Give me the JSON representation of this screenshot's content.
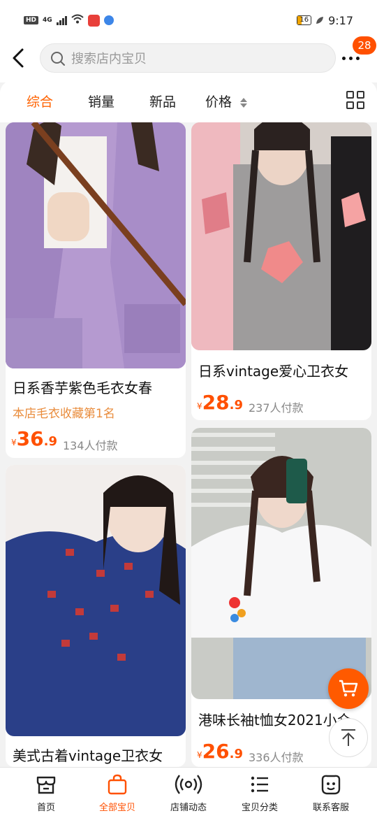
{
  "status_bar": {
    "hd": "HD",
    "network": "4G",
    "battery": "16",
    "time": "9:17"
  },
  "header": {
    "search_placeholder": "搜索店内宝贝",
    "message_badge": "28"
  },
  "sort_tabs": {
    "items": [
      "综合",
      "销量",
      "新品",
      "价格"
    ],
    "active": "综合"
  },
  "products": [
    {
      "title": "日系香芋紫色毛衣女春",
      "rank": "本店毛衣收藏第1名",
      "price_symbol": "¥",
      "price_int": "36",
      "price_dec": ".9",
      "sold": "134人付款",
      "image": "purple-cardigan-photo"
    },
    {
      "title": "日系vintage爱心卫衣女",
      "price_symbol": "¥",
      "price_int": "28",
      "price_dec": ".9",
      "sold": "237人付款",
      "image": "heart-sweatshirt-photo"
    },
    {
      "title": "美式古着vintage卫衣女",
      "image": "navy-sweatshirt-photo"
    },
    {
      "title": "港味长袖t恤女2021小众",
      "price_symbol": "¥",
      "price_int": "26",
      "price_dec": ".9",
      "sold": "336人付款",
      "image": "white-tshirt-photo"
    }
  ],
  "bottom_nav": {
    "items": [
      {
        "label": "首页",
        "icon": "store-icon"
      },
      {
        "label": "全部宝贝",
        "icon": "shopping-bag-icon"
      },
      {
        "label": "店铺动态",
        "icon": "broadcast-icon"
      },
      {
        "label": "宝贝分类",
        "icon": "list-icon"
      },
      {
        "label": "联系客服",
        "icon": "chat-face-icon"
      }
    ],
    "active": "全部宝贝"
  },
  "colors": {
    "accent": "#ff5000",
    "rank_text": "#e98c3c"
  }
}
